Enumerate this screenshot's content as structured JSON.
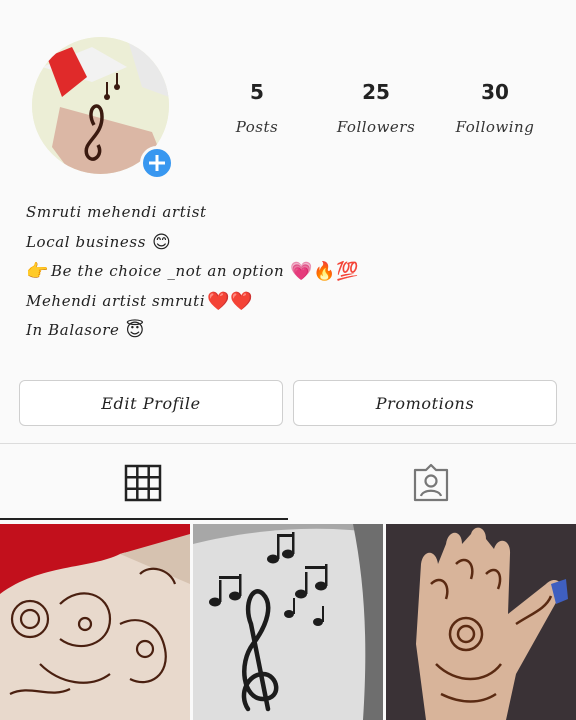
{
  "profile": {
    "avatar_icon": "profile-photo-icon",
    "add_icon": "plus-icon"
  },
  "stats": {
    "posts": {
      "value": "5",
      "label": "Posts"
    },
    "followers": {
      "value": "25",
      "label": "Followers"
    },
    "following": {
      "value": "30",
      "label": "Following"
    }
  },
  "bio": {
    "line1": "Smruti mehendi artist",
    "line2": "Local business",
    "line2_emoji": "😊",
    "line3_prefix_emoji": "👉",
    "line3": "Be the choice _not an option",
    "line3_emoji": "💗🔥💯",
    "line4": "Mehendi artist smruti",
    "line4_emoji": "❤️❤️",
    "line5": "In Balasore",
    "line5_emoji": "😇"
  },
  "buttons": {
    "edit_profile": "Edit Profile",
    "promotions": "Promotions"
  },
  "tabs": {
    "grid_icon": "grid-icon",
    "tagged_icon": "tagged-person-icon"
  },
  "colors": {
    "accent": "#3897f0",
    "background": "#fafafa"
  }
}
